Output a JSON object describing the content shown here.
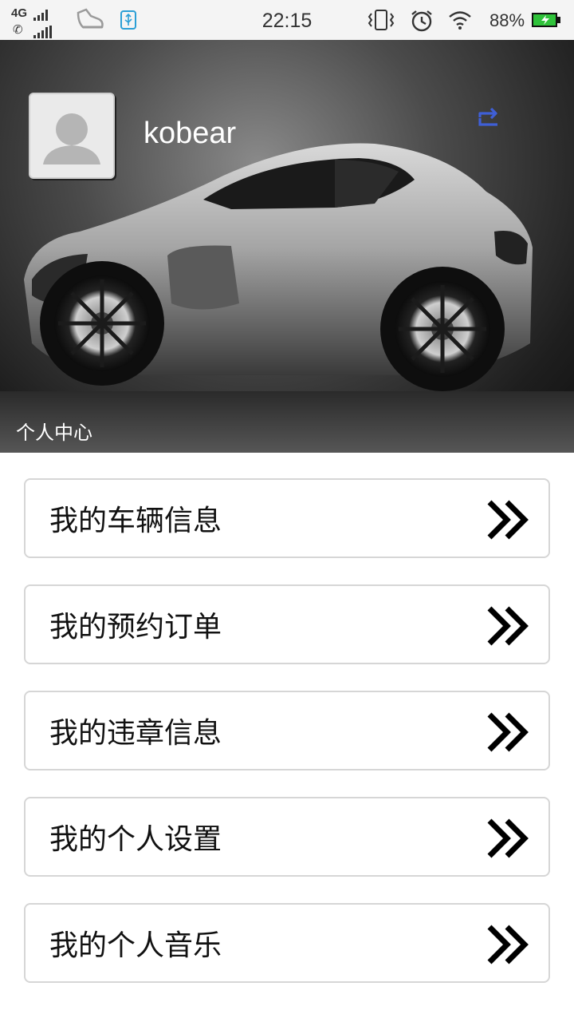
{
  "status_bar": {
    "network": "4G",
    "time": "22:15",
    "battery": "88%",
    "icons": [
      "call-icon",
      "sneaker-icon",
      "usb-icon",
      "vibrate-icon",
      "alarm-icon",
      "wifi-icon",
      "battery-icon"
    ]
  },
  "profile": {
    "username": "kobear",
    "section_label": "个人中心",
    "accent_color": "#3f5fd6"
  },
  "menu": {
    "items": [
      {
        "label": "我的车辆信息",
        "icon": "double-chevron-right-icon"
      },
      {
        "label": "我的预约订单",
        "icon": "double-chevron-right-icon"
      },
      {
        "label": "我的违章信息",
        "icon": "double-chevron-right-icon"
      },
      {
        "label": "我的个人设置",
        "icon": "double-chevron-right-icon"
      },
      {
        "label": "我的个人音乐",
        "icon": "double-chevron-right-icon"
      }
    ]
  }
}
